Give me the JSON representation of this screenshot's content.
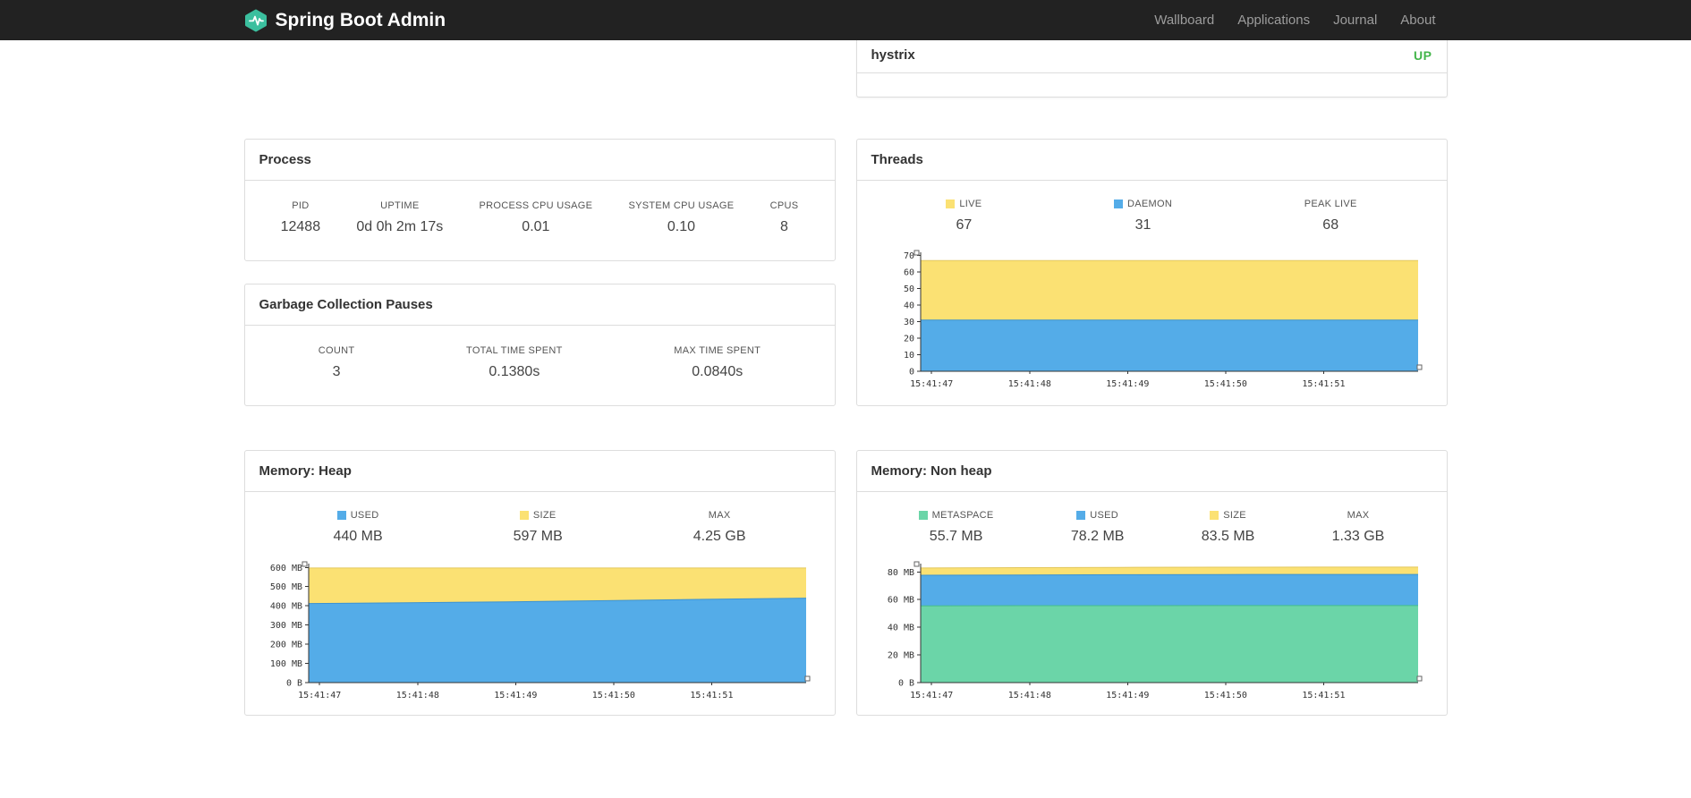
{
  "navbar": {
    "brand": "Spring Boot Admin",
    "links": [
      "Wallboard",
      "Applications",
      "Journal",
      "About"
    ]
  },
  "applications_panel": {
    "name": "hystrix",
    "status": "UP",
    "status_color": "#43B54A"
  },
  "process": {
    "title": "Process",
    "metrics": [
      {
        "label": "PID",
        "value": "12488"
      },
      {
        "label": "UPTIME",
        "value": "0d 0h 2m 17s"
      },
      {
        "label": "PROCESS CPU USAGE",
        "value": "0.01"
      },
      {
        "label": "SYSTEM CPU USAGE",
        "value": "0.10"
      },
      {
        "label": "CPUS",
        "value": "8"
      }
    ]
  },
  "gc": {
    "title": "Garbage Collection Pauses",
    "metrics": [
      {
        "label": "COUNT",
        "value": "3"
      },
      {
        "label": "TOTAL TIME SPENT",
        "value": "0.1380s"
      },
      {
        "label": "MAX TIME SPENT",
        "value": "0.0840s"
      }
    ]
  },
  "threads": {
    "title": "Threads",
    "legend": [
      {
        "label": "LIVE",
        "value": "67",
        "color": "#FBE173"
      },
      {
        "label": "DAEMON",
        "value": "31",
        "color": "#54ACE8"
      },
      {
        "label": "PEAK LIVE",
        "value": "68",
        "color": null
      }
    ]
  },
  "heap": {
    "title": "Memory: Heap",
    "legend": [
      {
        "label": "USED",
        "value": "440 MB",
        "color": "#54ACE8"
      },
      {
        "label": "SIZE",
        "value": "597 MB",
        "color": "#FBE173"
      },
      {
        "label": "MAX",
        "value": "4.25 GB",
        "color": null
      }
    ]
  },
  "nonheap": {
    "title": "Memory: Non heap",
    "legend": [
      {
        "label": "METASPACE",
        "value": "55.7 MB",
        "color": "#6BD5A8"
      },
      {
        "label": "USED",
        "value": "78.2 MB",
        "color": "#54ACE8"
      },
      {
        "label": "SIZE",
        "value": "83.5 MB",
        "color": "#FBE173"
      },
      {
        "label": "MAX",
        "value": "1.33 GB",
        "color": null
      }
    ]
  },
  "chart_data": [
    {
      "id": "threads",
      "type": "area",
      "stacked": true,
      "title": "Threads",
      "xlabel": "",
      "ylabel": "",
      "unit": "threads",
      "legend_position": "top",
      "grid": false,
      "x_labels": [
        "15:41:47",
        "15:41:48",
        "15:41:49",
        "15:41:50",
        "15:41:51"
      ],
      "ylim": [
        0,
        72
      ],
      "y_ticks": [
        {
          "v": 0,
          "label": "0"
        },
        {
          "v": 10,
          "label": "10"
        },
        {
          "v": 20,
          "label": "20"
        },
        {
          "v": 30,
          "label": "30"
        },
        {
          "v": 40,
          "label": "40"
        },
        {
          "v": 50,
          "label": "50"
        },
        {
          "v": 60,
          "label": "60"
        },
        {
          "v": 70,
          "label": "70"
        }
      ],
      "series": [
        {
          "name": "LIVE",
          "color": "#FBE173",
          "stroke": "#E2C75D",
          "values": [
            67,
            67,
            67,
            67,
            67,
            67
          ]
        },
        {
          "name": "DAEMON",
          "color": "#54ACE8",
          "stroke": "#3B92D2",
          "values": [
            31,
            31,
            31,
            31,
            31,
            31
          ]
        }
      ],
      "peak_live": 68
    },
    {
      "id": "heap",
      "type": "area",
      "stacked": true,
      "title": "Memory: Heap",
      "xlabel": "",
      "ylabel": "",
      "unit": "MB",
      "legend_position": "top",
      "grid": false,
      "x_labels": [
        "15:41:47",
        "15:41:48",
        "15:41:49",
        "15:41:50",
        "15:41:51"
      ],
      "ylim": [
        0,
        620
      ],
      "y_ticks": [
        {
          "v": 0,
          "label": "0 B"
        },
        {
          "v": 100,
          "label": "100 MB"
        },
        {
          "v": 200,
          "label": "200 MB"
        },
        {
          "v": 300,
          "label": "300 MB"
        },
        {
          "v": 400,
          "label": "400 MB"
        },
        {
          "v": 500,
          "label": "500 MB"
        },
        {
          "v": 600,
          "label": "600 MB"
        }
      ],
      "series": [
        {
          "name": "SIZE",
          "color": "#FBE173",
          "stroke": "#E2C75D",
          "values": [
            597,
            597,
            597,
            597,
            597,
            597
          ]
        },
        {
          "name": "USED",
          "color": "#54ACE8",
          "stroke": "#3B92D2",
          "values": [
            412,
            416,
            421,
            427,
            434,
            440
          ]
        }
      ],
      "max": "4.25 GB"
    },
    {
      "id": "nonheap",
      "type": "area",
      "stacked": true,
      "title": "Memory: Non heap",
      "xlabel": "",
      "ylabel": "",
      "unit": "MB",
      "legend_position": "top",
      "grid": false,
      "x_labels": [
        "15:41:47",
        "15:41:48",
        "15:41:49",
        "15:41:50",
        "15:41:51"
      ],
      "ylim": [
        0,
        86
      ],
      "y_ticks": [
        {
          "v": 0,
          "label": "0 B"
        },
        {
          "v": 20,
          "label": "20 MB"
        },
        {
          "v": 40,
          "label": "40 MB"
        },
        {
          "v": 60,
          "label": "60 MB"
        },
        {
          "v": 80,
          "label": "80 MB"
        }
      ],
      "series": [
        {
          "name": "SIZE",
          "color": "#FBE173",
          "stroke": "#E2C75D",
          "values": [
            82.8,
            83.1,
            83.3,
            83.4,
            83.5,
            83.5
          ]
        },
        {
          "name": "USED",
          "color": "#54ACE8",
          "stroke": "#3B92D2",
          "values": [
            77.6,
            77.8,
            78.0,
            78.1,
            78.2,
            78.2
          ]
        },
        {
          "name": "METASPACE",
          "color": "#6BD5A8",
          "stroke": "#45BE8B",
          "values": [
            55.5,
            55.6,
            55.6,
            55.7,
            55.7,
            55.7
          ]
        }
      ],
      "max": "1.33 GB"
    }
  ]
}
